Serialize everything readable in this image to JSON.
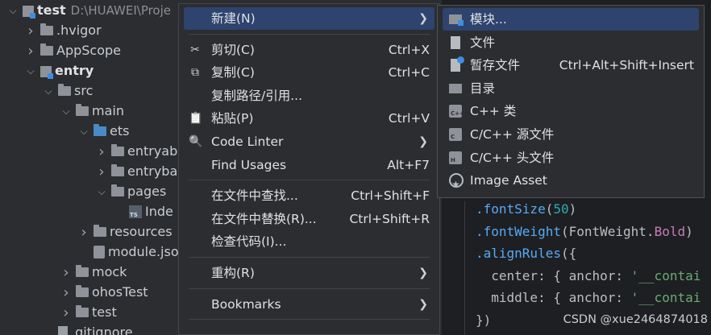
{
  "tree": [
    {
      "label": "test",
      "path": "D:\\HUAWEI\\Proje",
      "bold": true,
      "icon": "module",
      "chevron": "open",
      "indent": 0
    },
    {
      "label": ".hvigor",
      "icon": "folder",
      "chevron": "closed",
      "indent": 1
    },
    {
      "label": "AppScope",
      "icon": "folder",
      "chevron": "closed",
      "indent": 1
    },
    {
      "label": "entry",
      "icon": "module",
      "chevron": "open",
      "bold": true,
      "indent": 1
    },
    {
      "label": "src",
      "icon": "folder",
      "chevron": "open",
      "indent": 2
    },
    {
      "label": "main",
      "icon": "folder",
      "chevron": "open",
      "indent": 3
    },
    {
      "label": "ets",
      "icon": "folder-blue",
      "chevron": "open",
      "indent": 4
    },
    {
      "label": "entryab",
      "icon": "folder",
      "chevron": "closed",
      "indent": 5
    },
    {
      "label": "entryba",
      "icon": "folder",
      "chevron": "closed",
      "indent": 5
    },
    {
      "label": "pages",
      "icon": "folder",
      "chevron": "open",
      "indent": 5
    },
    {
      "label": "Inde",
      "icon": "ts",
      "chevron": "none",
      "indent": 6
    },
    {
      "label": "resources",
      "icon": "folder",
      "chevron": "closed",
      "indent": 4
    },
    {
      "label": "module.jso",
      "icon": "json",
      "chevron": "none",
      "indent": 4
    },
    {
      "label": "mock",
      "icon": "folder",
      "chevron": "closed",
      "indent": 3
    },
    {
      "label": "ohosTest",
      "icon": "folder",
      "chevron": "closed",
      "indent": 3
    },
    {
      "label": "test",
      "icon": "folder",
      "chevron": "closed",
      "indent": 3
    },
    {
      "label": ".gitignore",
      "icon": "file",
      "chevron": "none",
      "indent": 2
    }
  ],
  "context_menu": [
    {
      "type": "item",
      "label": "新建(N)",
      "submenu": true,
      "selected": true
    },
    {
      "type": "sep"
    },
    {
      "type": "item",
      "label": "剪切(C)",
      "icon": "✂",
      "shortcut": "Ctrl+X"
    },
    {
      "type": "item",
      "label": "复制(C)",
      "icon": "⧉",
      "shortcut": "Ctrl+C"
    },
    {
      "type": "item",
      "label": "复制路径/引用..."
    },
    {
      "type": "item",
      "label": "粘贴(P)",
      "icon": "📋",
      "shortcut": "Ctrl+V"
    },
    {
      "type": "item",
      "label": "Code Linter",
      "icon": "🔍",
      "submenu": true
    },
    {
      "type": "item",
      "label": "Find Usages",
      "shortcut": "Alt+F7"
    },
    {
      "type": "sep"
    },
    {
      "type": "item",
      "label": "在文件中查找...",
      "shortcut": "Ctrl+Shift+F"
    },
    {
      "type": "item",
      "label": "在文件中替换(R)...",
      "shortcut": "Ctrl+Shift+R"
    },
    {
      "type": "item",
      "label": "检查代码(I)..."
    },
    {
      "type": "sep"
    },
    {
      "type": "item",
      "label": "重构(R)",
      "submenu": true
    },
    {
      "type": "sep"
    },
    {
      "type": "item",
      "label": "Bookmarks",
      "submenu": true
    },
    {
      "type": "sep"
    }
  ],
  "submenu": [
    {
      "label": "模块...",
      "icon": "mod",
      "selected": true
    },
    {
      "label": "文件",
      "icon": "doc"
    },
    {
      "label": "暂存文件",
      "icon": "doc2",
      "shortcut": "Ctrl+Alt+Shift+Insert"
    },
    {
      "label": "目录",
      "icon": "fold"
    },
    {
      "label": "C++ 类",
      "icon": "cpp",
      "tag": "C++"
    },
    {
      "label": "C/C++ 源文件",
      "icon": "cpp",
      "tag": "C"
    },
    {
      "label": "C/C++ 头文件",
      "icon": "cpp",
      "tag": "H"
    },
    {
      "label": "Image Asset",
      "icon": "img"
    }
  ],
  "code": [
    {
      "parts": [
        [
          "fn",
          ".fontSize"
        ],
        [
          "key",
          "("
        ],
        [
          "num",
          "50"
        ],
        [
          "key",
          ")"
        ]
      ]
    },
    {
      "parts": [
        [
          "fn",
          ".fontWeight"
        ],
        [
          "key",
          "(FontWeight."
        ],
        [
          "obj",
          "Bold"
        ],
        [
          "key",
          ")"
        ]
      ]
    },
    {
      "parts": [
        [
          "fn",
          ".alignRules"
        ],
        [
          "key",
          "({"
        ]
      ]
    },
    {
      "parts": [
        [
          "key",
          "  center: { anchor: "
        ],
        [
          "str",
          "'__contai"
        ]
      ]
    },
    {
      "parts": [
        [
          "key",
          "  middle: { anchor: "
        ],
        [
          "str",
          "'__contai"
        ]
      ]
    },
    {
      "parts": [
        [
          "key",
          "})"
        ]
      ]
    }
  ],
  "watermark": "CSDN @xue2464874018"
}
